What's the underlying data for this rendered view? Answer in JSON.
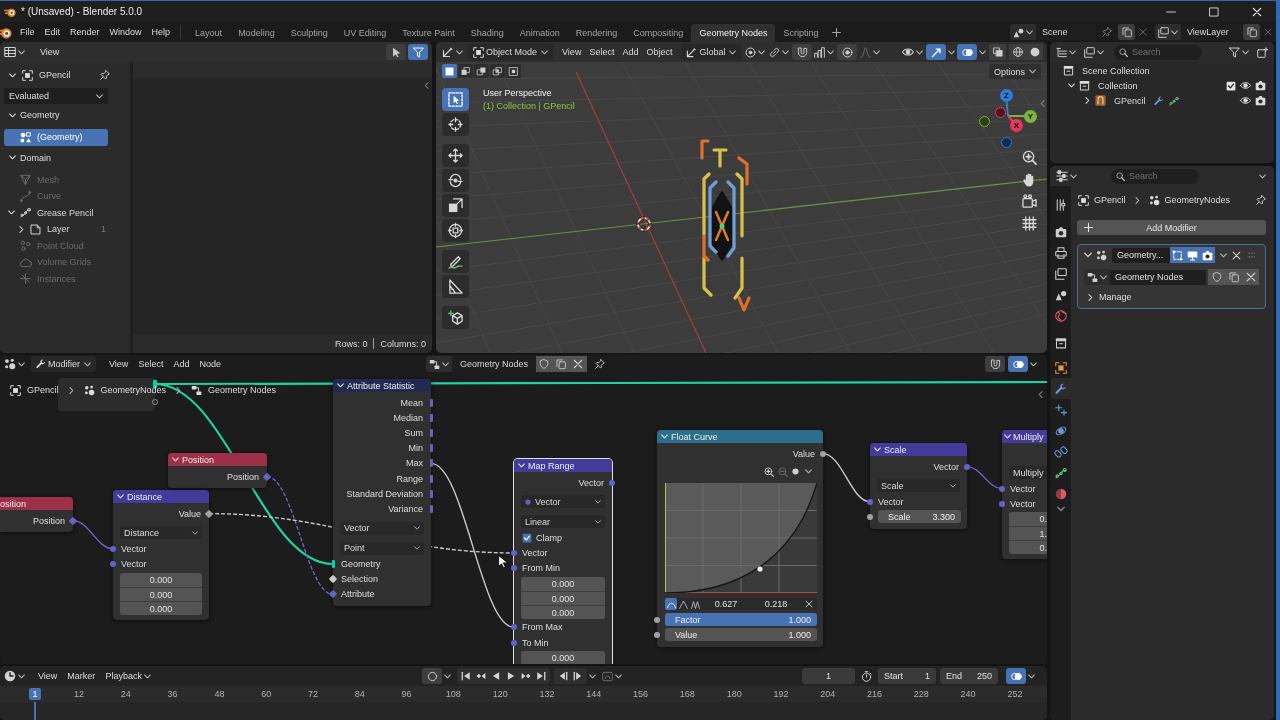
{
  "window": {
    "title": "* (Unsaved) - Blender 5.0.0"
  },
  "topbar": {
    "menus": [
      "File",
      "Edit",
      "Render",
      "Window",
      "Help"
    ],
    "workspaces": [
      {
        "label": "Layout",
        "selected": false
      },
      {
        "label": "Modeling",
        "selected": false
      },
      {
        "label": "Sculpting",
        "selected": false
      },
      {
        "label": "UV Editing",
        "selected": false
      },
      {
        "label": "Texture Paint",
        "selected": false
      },
      {
        "label": "Shading",
        "selected": false
      },
      {
        "label": "Animation",
        "selected": false
      },
      {
        "label": "Rendering",
        "selected": false
      },
      {
        "label": "Compositing",
        "selected": false
      },
      {
        "label": "Geometry Nodes",
        "selected": true
      },
      {
        "label": "Scripting",
        "selected": false
      }
    ],
    "scene": "Scene",
    "view_layer": "ViewLayer"
  },
  "spreadsheet": {
    "menus": [
      "View"
    ],
    "toggles": [
      {
        "on": false
      },
      {
        "on": true
      }
    ],
    "object": "GPencil",
    "evaluation": "Evaluated",
    "sections": [
      {
        "label": "Geometry",
        "expanded": true,
        "items": [
          {
            "label": "(Geometry)",
            "selected": true,
            "disabled": false
          }
        ]
      },
      {
        "label": "Domain",
        "expanded": true,
        "items": [
          {
            "label": "Mesh",
            "selected": false,
            "disabled": true
          },
          {
            "label": "Curve",
            "selected": false,
            "disabled": true
          },
          {
            "label": "Grease Pencil",
            "selected": false,
            "disabled": false,
            "expanded": true,
            "children": [
              {
                "label": "Layer",
                "count": "1",
                "selected": false,
                "disabled": false,
                "expanded": false
              }
            ]
          },
          {
            "label": "Point Cloud",
            "selected": false,
            "disabled": true
          },
          {
            "label": "Volume Grids",
            "selected": false,
            "disabled": true
          },
          {
            "label": "Instances",
            "selected": false,
            "disabled": true
          }
        ]
      }
    ],
    "rows": "Rows: 0",
    "columns": "Columns: 0"
  },
  "viewport": {
    "mode": "Object Mode",
    "menus": [
      "View",
      "Select",
      "Add",
      "Object"
    ],
    "orientation": "Global",
    "toggles": [
      {
        "on": false
      },
      {
        "on": false
      },
      {
        "on": true
      },
      {
        "on": true
      }
    ],
    "select_modes": [
      {
        "selected": true
      },
      {
        "selected": false
      },
      {
        "selected": false
      },
      {
        "selected": false
      },
      {
        "selected": false
      }
    ],
    "options": "Options",
    "tools": [
      {
        "selected": true
      },
      {
        "selected": false
      },
      {
        "selected": false
      },
      {
        "selected": false
      },
      {
        "selected": false
      },
      {
        "selected": false
      },
      {
        "selected": false
      },
      {
        "selected": false
      },
      {
        "selected": false
      }
    ],
    "view_name": "User Perspective",
    "view_info": "(1) Collection | GPencil",
    "axes": [
      {
        "label": "Z",
        "color": "#2f7bd5"
      },
      {
        "label": "Y",
        "color": "#7fb43c"
      },
      {
        "label": "X",
        "color": "#e53a5a"
      }
    ]
  },
  "outliner": {
    "search": {
      "placeholder": "Search"
    },
    "tree": [
      {
        "label": "Scene Collection",
        "children": [
          {
            "label": "Collection",
            "expanded": true,
            "checked": true,
            "children": [
              {
                "label": "GPencil",
                "expanded": false
              }
            ]
          }
        ]
      }
    ]
  },
  "properties": {
    "search": {
      "placeholder": "Search"
    },
    "tabs": [
      {
        "selected": false
      },
      {
        "selected": false
      },
      {
        "selected": false
      },
      {
        "selected": false
      },
      {
        "selected": false
      },
      {
        "selected": false
      },
      {
        "selected": false
      },
      {
        "selected": false
      },
      {
        "selected": true
      },
      {
        "selected": false
      },
      {
        "selected": false
      },
      {
        "selected": false
      },
      {
        "selected": false
      },
      {
        "selected": false
      }
    ],
    "breadcrumb": [
      "GPencil",
      "GeometryNodes"
    ],
    "add_modifier": "Add Modifier",
    "modifier": {
      "name": "Geometry...",
      "expanded": true,
      "toggles": [
        {
          "on": true
        },
        {
          "on": true
        },
        {
          "on": true
        }
      ],
      "node_group": "Geometry Nodes",
      "panels": [
        {
          "label": "Manage",
          "expanded": false
        }
      ]
    }
  },
  "node_editor": {
    "context": "Modifier",
    "menus": [
      "View",
      "Select",
      "Add",
      "Node"
    ],
    "node_group": "Geometry Nodes",
    "toggles": [
      {
        "on": false
      },
      {
        "on": true
      }
    ],
    "breadcrumb": [
      "GPencil",
      "GeometryNodes",
      "Geometry Nodes"
    ],
    "nodes": [
      {
        "title": "Attribute Statistic",
        "color": "#232a52",
        "selected": false,
        "rows": [
          {
            "kind": "output",
            "label": "Mean",
            "socket": {
              "kind": "bar",
              "color": "#6363c7"
            }
          },
          {
            "kind": "output",
            "label": "Median",
            "socket": {
              "kind": "bar",
              "color": "#6363c7"
            }
          },
          {
            "kind": "output",
            "label": "Sum",
            "socket": {
              "kind": "bar",
              "color": "#6363c7"
            }
          },
          {
            "kind": "output",
            "label": "Min",
            "socket": {
              "kind": "bar",
              "color": "#6363c7"
            }
          },
          {
            "kind": "output",
            "label": "Max",
            "socket": {
              "kind": "bar",
              "color": "#6363c7"
            }
          },
          {
            "kind": "output",
            "label": "Range",
            "socket": {
              "kind": "bar",
              "color": "#6363c7"
            }
          },
          {
            "kind": "output",
            "label": "Standard Deviation",
            "socket": {
              "kind": "bar",
              "color": "#6363c7"
            }
          },
          {
            "kind": "output",
            "label": "Variance",
            "socket": {
              "kind": "bar",
              "color": "#6363c7"
            }
          },
          {
            "kind": "dropdown",
            "label": "Vector"
          },
          {
            "kind": "dropdown",
            "label": "Point"
          },
          {
            "kind": "input",
            "label": "Geometry",
            "socket": {
              "kind": "bar",
              "color": "#00d6a3"
            }
          },
          {
            "kind": "input",
            "label": "Selection",
            "socket": {
              "kind": "diamond",
              "color": "#cccccc"
            }
          },
          {
            "kind": "input",
            "label": "Attribute",
            "socket": {
              "kind": "diamond",
              "color": "#6363c7"
            }
          }
        ]
      },
      {
        "title": "Float Curve",
        "color": "#2b6f8c",
        "selected": false,
        "rows": [
          {
            "kind": "output",
            "label": "Value",
            "socket": {
              "kind": "circle",
              "color": "#a1a1a1"
            }
          },
          {
            "kind": "curve",
            "handles": [
              {
                "selected": true
              },
              {
                "selected": false
              },
              {
                "selected": false
              }
            ],
            "values": [
              "0.627",
              "0.218"
            ]
          },
          {
            "kind": "slider",
            "label": "Factor",
            "value": "1.000",
            "level": 1,
            "socket": {
              "kind": "circle",
              "color": "#a1a1a1"
            }
          },
          {
            "kind": "field",
            "label": "Value",
            "value": "1.000",
            "socket": {
              "kind": "circle",
              "color": "#a1a1a1"
            }
          }
        ]
      },
      {
        "title": "Multiply",
        "color": "#45399a",
        "selected": false,
        "rows": [
          {
            "kind": "dropdown",
            "label": "Multiply"
          },
          {
            "kind": "input",
            "label": "Vector",
            "socket": {
              "kind": "circle",
              "color": "#6363c7"
            }
          },
          {
            "kind": "input",
            "label": "Vector",
            "socket": {
              "kind": "circle",
              "color": "#6363c7"
            }
          },
          {
            "kind": "values",
            "values": [
              "0.",
              "1.",
              "0."
            ]
          }
        ]
      },
      {
        "title": "Scale",
        "color": "#45399a",
        "selected": false,
        "rows": [
          {
            "kind": "output",
            "label": "Vector",
            "socket": {
              "kind": "circle",
              "color": "#6363c7"
            }
          },
          {
            "kind": "dropdown",
            "label": "Scale"
          },
          {
            "kind": "input",
            "label": "Vector",
            "socket": {
              "kind": "circle",
              "color": "#6363c7"
            }
          },
          {
            "kind": "field",
            "label": "Scale",
            "value": "3.300",
            "socket": {
              "kind": "circle",
              "color": "#a1a1a1"
            }
          }
        ]
      },
      {
        "title": "Position",
        "color": "#9b3048",
        "selected": false,
        "rows": [
          {
            "kind": "output",
            "label": "Position",
            "socket": {
              "kind": "diamond",
              "color": "#6363c7"
            }
          }
        ]
      },
      {
        "title": "Map Range",
        "color": "#45399a",
        "selected": true,
        "rows": [
          {
            "kind": "output",
            "label": "Vector",
            "socket": {
              "kind": "circle",
              "color": "#6363c7"
            }
          },
          {
            "kind": "typedropdown",
            "label": "Vector"
          },
          {
            "kind": "dropdown",
            "label": "Linear"
          },
          {
            "kind": "checkbox",
            "label": "Clamp",
            "checked": true
          },
          {
            "kind": "input",
            "label": "Vector",
            "socket": {
              "kind": "circle",
              "color": "#6363c7"
            }
          },
          {
            "kind": "input",
            "label": "From Min",
            "socket": {
              "kind": "circle",
              "color": "#6363c7"
            }
          },
          {
            "kind": "values",
            "values": [
              "0.000",
              "0.000",
              "0.000"
            ]
          },
          {
            "kind": "input",
            "label": "From Max",
            "socket": {
              "kind": "circle",
              "color": "#6363c7"
            }
          },
          {
            "kind": "input",
            "label": "To Min",
            "socket": {
              "kind": "circle",
              "color": "#6363c7"
            }
          },
          {
            "kind": "values",
            "values": [
              "0.000"
            ]
          }
        ]
      },
      {
        "title": "Distance",
        "color": "#45399a",
        "selected": false,
        "rows": [
          {
            "kind": "output",
            "label": "Value",
            "socket": {
              "kind": "diamond",
              "color": "#a1a1a1"
            }
          },
          {
            "kind": "dropdown",
            "label": "Distance"
          },
          {
            "kind": "input",
            "label": "Vector",
            "socket": {
              "kind": "circle",
              "color": "#6363c7"
            }
          },
          {
            "kind": "input",
            "label": "Vector",
            "socket": {
              "kind": "circle",
              "color": "#6363c7"
            }
          },
          {
            "kind": "values",
            "values": [
              "0.000",
              "0.000",
              "0.000"
            ]
          }
        ]
      },
      {
        "title": "osition",
        "color": "#9b3048",
        "selected": false,
        "rows": [
          {
            "kind": "output",
            "label": "Position",
            "socket": {
              "kind": "diamond",
              "color": "#6363c7"
            }
          }
        ]
      }
    ]
  },
  "timeline": {
    "menus": [
      "View",
      "Marker"
    ],
    "playback": "Playback",
    "toggles": [
      {
        "on": false
      },
      {
        "on": true
      }
    ],
    "frame": "1",
    "start_label": "Start",
    "start": "1",
    "end_label": "End",
    "end": "250",
    "current": "1",
    "ruler": [
      "12",
      "24",
      "36",
      "48",
      "60",
      "72",
      "84",
      "96",
      "108",
      "120",
      "132",
      "144",
      "156",
      "168",
      "180",
      "192",
      "204",
      "216",
      "228",
      "240",
      "252"
    ]
  }
}
